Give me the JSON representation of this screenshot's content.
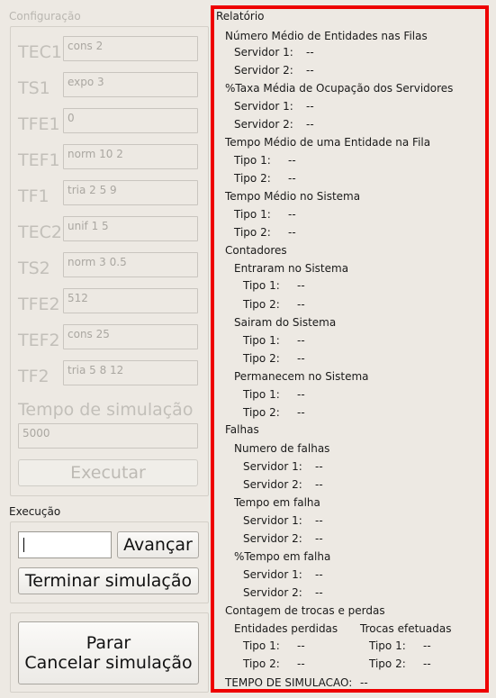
{
  "config": {
    "title": "Configuração",
    "fields": [
      {
        "label": "TEC1",
        "value": "cons 2"
      },
      {
        "label": "TS1",
        "value": "expo 3"
      },
      {
        "label": "TFE1",
        "value": "0"
      },
      {
        "label": "TEF1",
        "value": "norm 10 2"
      },
      {
        "label": "TF1",
        "value": "tria 2 5 9"
      },
      {
        "label": "TEC2",
        "value": "unif 1 5"
      },
      {
        "label": "TS2",
        "value": "norm 3 0.5"
      },
      {
        "label": "TFE2",
        "value": "512"
      },
      {
        "label": "TEF2",
        "value": "cons 25"
      },
      {
        "label": "TF2",
        "value": "tria 5 8 12"
      }
    ],
    "sim_time_label": "Tempo de simulação",
    "sim_time_value": "5000",
    "execute_label": "Executar"
  },
  "execution": {
    "title": "Execução",
    "step_value": "",
    "advance_label": "Avançar",
    "finish_label": "Terminar simulação"
  },
  "stop": {
    "line1": "Parar",
    "line2": "Cancelar simulação"
  },
  "report": {
    "title": "Relatório",
    "entities_title": "Número Médio de Entidades nas Filas",
    "entities_s1": "Servidor 1:",
    "entities_s1_val": "--",
    "entities_s2": "Servidor 2:",
    "entities_s2_val": "--",
    "occupancy_title": "%Taxa Média de Ocupação dos Servidores",
    "occ_s1": "Servidor 1:",
    "occ_s1_val": "--",
    "occ_s2": "Servidor 2:",
    "occ_s2_val": "--",
    "queue_time_title": "Tempo Médio de uma Entidade na Fila",
    "qt_t1": "Tipo 1:",
    "qt_t1_val": "--",
    "qt_t2": "Tipo 2:",
    "qt_t2_val": "--",
    "system_time_title": "Tempo Médio no Sistema",
    "st_t1": "Tipo 1:",
    "st_t1_val": "--",
    "st_t2": "Tipo 2:",
    "st_t2_val": "--",
    "counters_title": "Contadores",
    "entered_title": "Entraram no Sistema",
    "en_t1": "Tipo 1:",
    "en_t1_val": "--",
    "en_t2": "Tipo 2:",
    "en_t2_val": "--",
    "exited_title": "Sairam do Sistema",
    "ex_t1": "Tipo 1:",
    "ex_t1_val": "--",
    "ex_t2": "Tipo 2:",
    "ex_t2_val": "--",
    "remain_title": "Permanecem no Sistema",
    "rm_t1": "Tipo 1:",
    "rm_t1_val": "--",
    "rm_t2": "Tipo 2:",
    "rm_t2_val": "--",
    "failures_title": "Falhas",
    "fail_count_title": "Numero de falhas",
    "fc_s1": "Servidor 1:",
    "fc_s1_val": "--",
    "fc_s2": "Servidor 2:",
    "fc_s2_val": "--",
    "fail_time_title": "Tempo em falha",
    "ft_s1": "Servidor 1:",
    "ft_s1_val": "--",
    "ft_s2": "Servidor 2:",
    "ft_s2_val": "--",
    "fail_pct_title": "%Tempo em falha",
    "fp_s1": "Servidor 1:",
    "fp_s1_val": "--",
    "fp_s2": "Servidor 2:",
    "fp_s2_val": "--",
    "swaps_title": "Contagem de trocas e perdas",
    "lost_title": "Entidades perdidas",
    "lost_t1": "Tipo 1:",
    "lost_t1_val": "--",
    "lost_t2": "Tipo 2:",
    "lost_t2_val": "--",
    "swaps_done_title": "Trocas efetuadas",
    "sw_t1": "Tipo 1:",
    "sw_t1_val": "--",
    "sw_t2": "Tipo 2:",
    "sw_t2_val": "--",
    "sim_time_label": "TEMPO DE SIMULACAO:",
    "sim_time_val": "--"
  }
}
